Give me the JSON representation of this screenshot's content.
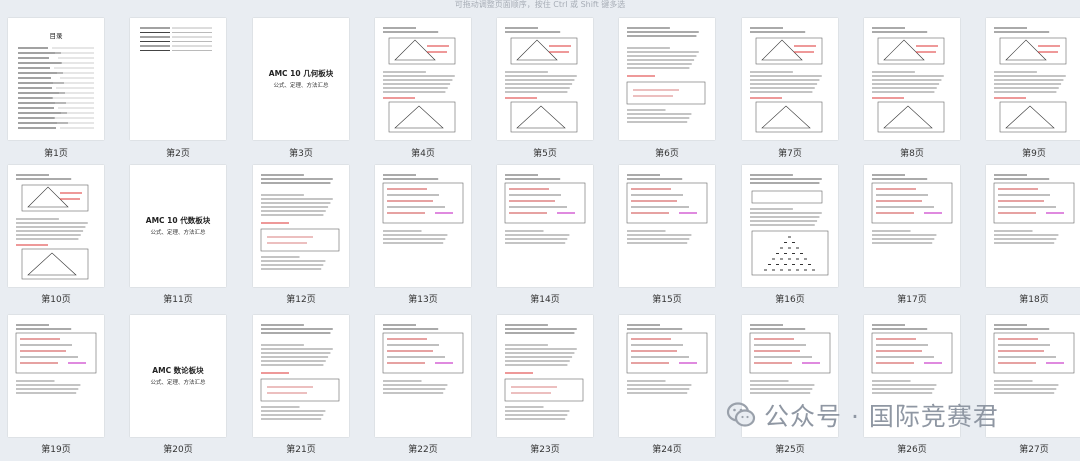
{
  "hint_text": "可拖动调整页面顺序，按住 Ctrl 或 Shift 键多选",
  "pages": [
    {
      "caption": "第1页",
      "kind": "toc",
      "title": "目录"
    },
    {
      "caption": "第2页",
      "kind": "list"
    },
    {
      "caption": "第3页",
      "kind": "cover",
      "title": "AMC 10 几何板块",
      "subtitle": "公式、定理、方法汇总"
    },
    {
      "caption": "第4页",
      "kind": "figure"
    },
    {
      "caption": "第5页",
      "kind": "figure"
    },
    {
      "caption": "第6页",
      "kind": "text"
    },
    {
      "caption": "第7页",
      "kind": "figure"
    },
    {
      "caption": "第8页",
      "kind": "figure"
    },
    {
      "caption": "第9页",
      "kind": "figure"
    },
    {
      "caption": "第10页",
      "kind": "figure"
    },
    {
      "caption": "第11页",
      "kind": "cover",
      "title": "AMC 10 代数板块",
      "subtitle": "公式、定理、方法汇总"
    },
    {
      "caption": "第12页",
      "kind": "text"
    },
    {
      "caption": "第13页",
      "kind": "formula"
    },
    {
      "caption": "第14页",
      "kind": "formula"
    },
    {
      "caption": "第15页",
      "kind": "formula"
    },
    {
      "caption": "第16页",
      "kind": "triangle"
    },
    {
      "caption": "第17页",
      "kind": "formula"
    },
    {
      "caption": "第18页",
      "kind": "formula"
    },
    {
      "caption": "第19页",
      "kind": "formula"
    },
    {
      "caption": "第20页",
      "kind": "cover",
      "title": "AMC 数论板块",
      "subtitle": "公式、定理、方法汇总"
    },
    {
      "caption": "第21页",
      "kind": "text"
    },
    {
      "caption": "第22页",
      "kind": "formula"
    },
    {
      "caption": "第23页",
      "kind": "text"
    },
    {
      "caption": "第24页",
      "kind": "formula"
    },
    {
      "caption": "第25页",
      "kind": "formula"
    },
    {
      "caption": "第26页",
      "kind": "formula"
    },
    {
      "caption": "第27页",
      "kind": "formula"
    }
  ],
  "watermark": {
    "icon": "wechat-icon",
    "text": "公众号 · 国际竞赛君"
  }
}
